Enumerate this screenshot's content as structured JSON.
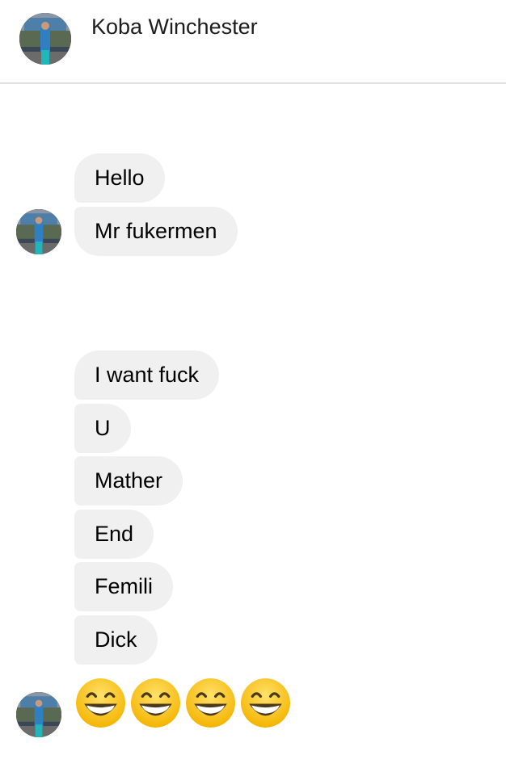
{
  "header": {
    "contact_name": "Koba Winchester"
  },
  "messages": {
    "group1": [
      "Hello",
      "Mr fukermen"
    ],
    "group2": [
      "I want fuck",
      "U",
      "Mather",
      "End",
      "Femili",
      "Dick"
    ],
    "emoji_count": 4
  },
  "icons": {
    "emoji": "grinning-face-icon",
    "avatar": "profile-photo"
  }
}
